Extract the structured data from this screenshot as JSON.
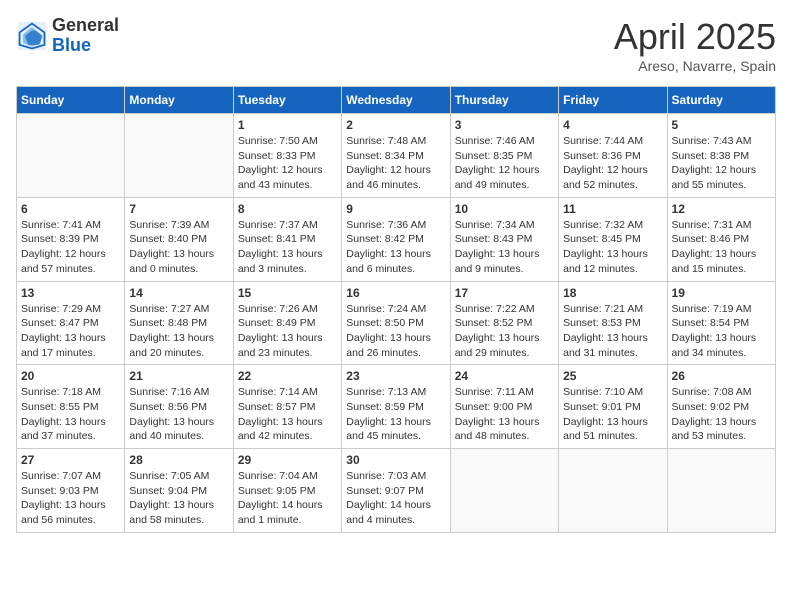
{
  "header": {
    "logo_general": "General",
    "logo_blue": "Blue",
    "month_title": "April 2025",
    "subtitle": "Areso, Navarre, Spain"
  },
  "days_of_week": [
    "Sunday",
    "Monday",
    "Tuesday",
    "Wednesday",
    "Thursday",
    "Friday",
    "Saturday"
  ],
  "weeks": [
    [
      {
        "day": "",
        "content": ""
      },
      {
        "day": "",
        "content": ""
      },
      {
        "day": "1",
        "content": "Sunrise: 7:50 AM\nSunset: 8:33 PM\nDaylight: 12 hours and 43 minutes."
      },
      {
        "day": "2",
        "content": "Sunrise: 7:48 AM\nSunset: 8:34 PM\nDaylight: 12 hours and 46 minutes."
      },
      {
        "day": "3",
        "content": "Sunrise: 7:46 AM\nSunset: 8:35 PM\nDaylight: 12 hours and 49 minutes."
      },
      {
        "day": "4",
        "content": "Sunrise: 7:44 AM\nSunset: 8:36 PM\nDaylight: 12 hours and 52 minutes."
      },
      {
        "day": "5",
        "content": "Sunrise: 7:43 AM\nSunset: 8:38 PM\nDaylight: 12 hours and 55 minutes."
      }
    ],
    [
      {
        "day": "6",
        "content": "Sunrise: 7:41 AM\nSunset: 8:39 PM\nDaylight: 12 hours and 57 minutes."
      },
      {
        "day": "7",
        "content": "Sunrise: 7:39 AM\nSunset: 8:40 PM\nDaylight: 13 hours and 0 minutes."
      },
      {
        "day": "8",
        "content": "Sunrise: 7:37 AM\nSunset: 8:41 PM\nDaylight: 13 hours and 3 minutes."
      },
      {
        "day": "9",
        "content": "Sunrise: 7:36 AM\nSunset: 8:42 PM\nDaylight: 13 hours and 6 minutes."
      },
      {
        "day": "10",
        "content": "Sunrise: 7:34 AM\nSunset: 8:43 PM\nDaylight: 13 hours and 9 minutes."
      },
      {
        "day": "11",
        "content": "Sunrise: 7:32 AM\nSunset: 8:45 PM\nDaylight: 13 hours and 12 minutes."
      },
      {
        "day": "12",
        "content": "Sunrise: 7:31 AM\nSunset: 8:46 PM\nDaylight: 13 hours and 15 minutes."
      }
    ],
    [
      {
        "day": "13",
        "content": "Sunrise: 7:29 AM\nSunset: 8:47 PM\nDaylight: 13 hours and 17 minutes."
      },
      {
        "day": "14",
        "content": "Sunrise: 7:27 AM\nSunset: 8:48 PM\nDaylight: 13 hours and 20 minutes."
      },
      {
        "day": "15",
        "content": "Sunrise: 7:26 AM\nSunset: 8:49 PM\nDaylight: 13 hours and 23 minutes."
      },
      {
        "day": "16",
        "content": "Sunrise: 7:24 AM\nSunset: 8:50 PM\nDaylight: 13 hours and 26 minutes."
      },
      {
        "day": "17",
        "content": "Sunrise: 7:22 AM\nSunset: 8:52 PM\nDaylight: 13 hours and 29 minutes."
      },
      {
        "day": "18",
        "content": "Sunrise: 7:21 AM\nSunset: 8:53 PM\nDaylight: 13 hours and 31 minutes."
      },
      {
        "day": "19",
        "content": "Sunrise: 7:19 AM\nSunset: 8:54 PM\nDaylight: 13 hours and 34 minutes."
      }
    ],
    [
      {
        "day": "20",
        "content": "Sunrise: 7:18 AM\nSunset: 8:55 PM\nDaylight: 13 hours and 37 minutes."
      },
      {
        "day": "21",
        "content": "Sunrise: 7:16 AM\nSunset: 8:56 PM\nDaylight: 13 hours and 40 minutes."
      },
      {
        "day": "22",
        "content": "Sunrise: 7:14 AM\nSunset: 8:57 PM\nDaylight: 13 hours and 42 minutes."
      },
      {
        "day": "23",
        "content": "Sunrise: 7:13 AM\nSunset: 8:59 PM\nDaylight: 13 hours and 45 minutes."
      },
      {
        "day": "24",
        "content": "Sunrise: 7:11 AM\nSunset: 9:00 PM\nDaylight: 13 hours and 48 minutes."
      },
      {
        "day": "25",
        "content": "Sunrise: 7:10 AM\nSunset: 9:01 PM\nDaylight: 13 hours and 51 minutes."
      },
      {
        "day": "26",
        "content": "Sunrise: 7:08 AM\nSunset: 9:02 PM\nDaylight: 13 hours and 53 minutes."
      }
    ],
    [
      {
        "day": "27",
        "content": "Sunrise: 7:07 AM\nSunset: 9:03 PM\nDaylight: 13 hours and 56 minutes."
      },
      {
        "day": "28",
        "content": "Sunrise: 7:05 AM\nSunset: 9:04 PM\nDaylight: 13 hours and 58 minutes."
      },
      {
        "day": "29",
        "content": "Sunrise: 7:04 AM\nSunset: 9:05 PM\nDaylight: 14 hours and 1 minute."
      },
      {
        "day": "30",
        "content": "Sunrise: 7:03 AM\nSunset: 9:07 PM\nDaylight: 14 hours and 4 minutes."
      },
      {
        "day": "",
        "content": ""
      },
      {
        "day": "",
        "content": ""
      },
      {
        "day": "",
        "content": ""
      }
    ]
  ]
}
